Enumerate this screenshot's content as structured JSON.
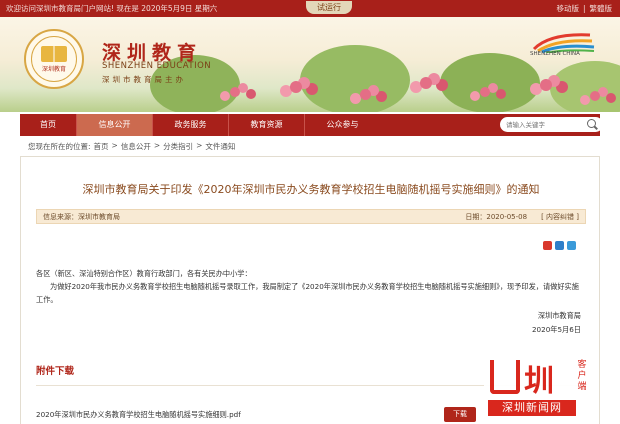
{
  "topbar": {
    "welcome": "欢迎访问深圳市教育局门户网站! 现在是 2020年5月9日 星期六",
    "trial": "试运行",
    "mobile": "移动版",
    "divider": "|",
    "traditional": "繁體版"
  },
  "header": {
    "logo_text": "深圳教育",
    "site_name_cn": "深圳教育",
    "site_name_en": "SHENZHEN EDUCATION",
    "site_subtitle": "深圳市教育局主办",
    "city_logo_text": "SHENZHEN CHINA"
  },
  "nav": {
    "items": [
      {
        "label": "首页"
      },
      {
        "label": "信息公开"
      },
      {
        "label": "政务服务"
      },
      {
        "label": "教育资源"
      },
      {
        "label": "公众参与"
      }
    ],
    "search_placeholder": "请输入关键字"
  },
  "breadcrumb": {
    "prefix": "您现在所在的位置:",
    "items": [
      "首页",
      "信息公开",
      "分类指引",
      "文件通知"
    ],
    "separator": ">"
  },
  "article": {
    "title": "深圳市教育局关于印发《2020年深圳市民办义务教育学校招生电脑随机摇号实施细则》的通知",
    "source": "信息来源：深圳市教育局",
    "date": "日期：2020-05-08",
    "feedback": "[ 内容纠错 ]",
    "salutation": "各区（新区、深汕特别合作区）教育行政部门，各有关民办中小学：",
    "body": "为做好2020年我市民办义务教育学校招生电脑随机摇号录取工作，我局制定了《2020年深圳市民办义务教育学校招生电脑随机摇号实施细则》，现予印发，请做好实施工作。",
    "signature": "深圳市教育局",
    "sign_date": "2020年5月6日"
  },
  "attachments": {
    "title": "附件下载",
    "file_name": "2020年深圳市民办义务教育学校招生电脑随机摇号实施细则.pdf",
    "download_label": "下载"
  },
  "watermark": {
    "char": "圳",
    "vertical": "客户端",
    "bar": "深圳新闻网"
  },
  "colors": {
    "brand_red": "#a8201a",
    "nav_active": "#cc6a4f",
    "title_brown": "#8a4b1f",
    "meta_bg": "#f8ead4"
  }
}
